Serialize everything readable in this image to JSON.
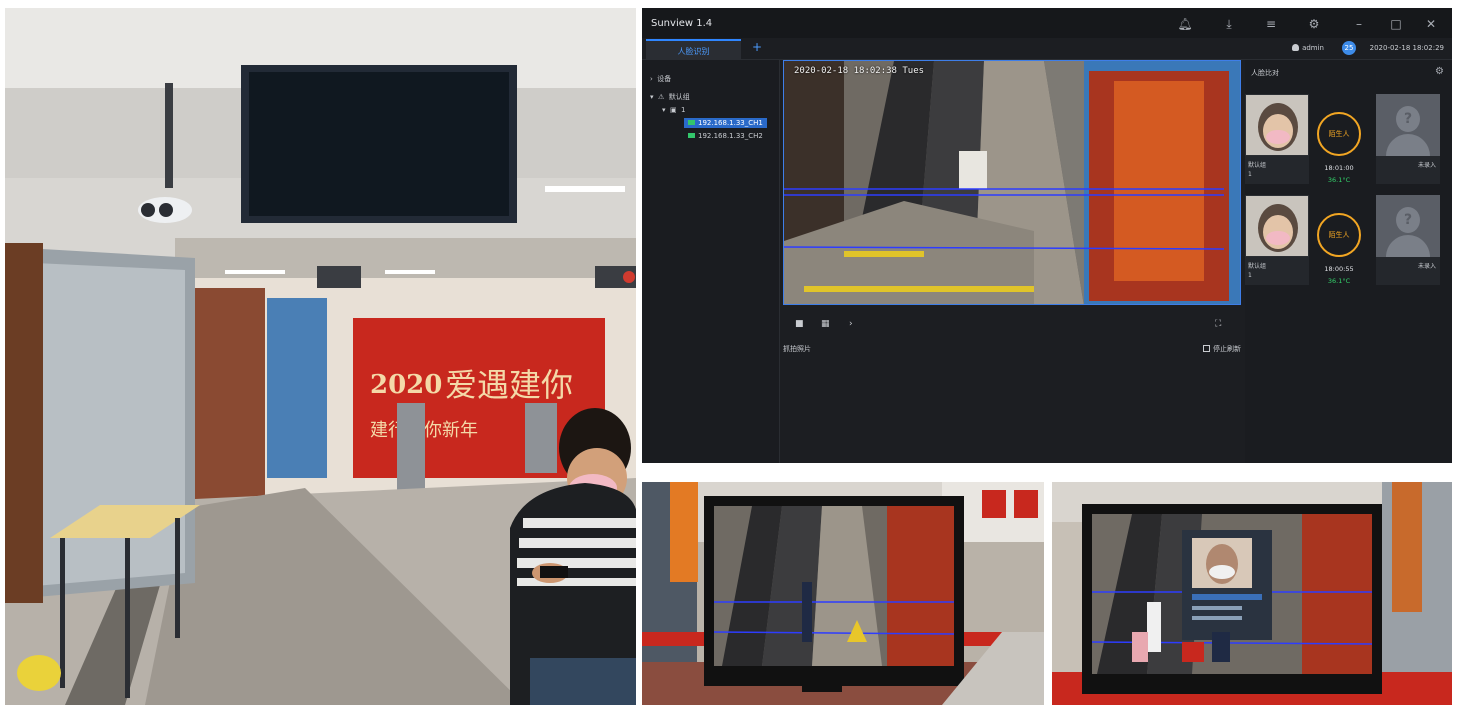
{
  "app": {
    "title": "Sunview 1.4",
    "tab_active": "人脸识别",
    "tab_add": "+",
    "user": "admin",
    "badge": "25",
    "datetime": "2020-02-18 18:02:29",
    "icons": [
      "bell-icon",
      "download-icon",
      "menu-icon",
      "settings-icon",
      "minimize-icon",
      "maximize-icon",
      "close-icon"
    ]
  },
  "tree": {
    "root": "设备",
    "group": "默认组",
    "node": "1",
    "channels": [
      "192.168.1.33_CH1",
      "192.168.1.33_CH2"
    ]
  },
  "video": {
    "timestamp": "2020-02-18 18:02:38 Tues"
  },
  "snapshots": {
    "label": "抓拍照片",
    "stop_refresh": "停止刷新"
  },
  "panel": {
    "title": "人脸比对",
    "matches": [
      {
        "group": "默认组",
        "id": "1",
        "status": "陌生人",
        "time": "18:01:00",
        "temp": "36.1°C",
        "unknown_label": "未录入"
      },
      {
        "group": "默认组",
        "id": "1",
        "status": "陌生人",
        "time": "18:00:55",
        "temp": "36.1°C",
        "unknown_label": "未录入"
      }
    ]
  },
  "photos": {
    "banner_year": "2020",
    "banner_text": "爱遇建你",
    "banner_sub": "建行祝你新年"
  },
  "colors": {
    "accent": "#2f86ff",
    "alarm": "#f2a623",
    "temp_ok": "#33d06a",
    "banner_red": "#c8281e"
  }
}
